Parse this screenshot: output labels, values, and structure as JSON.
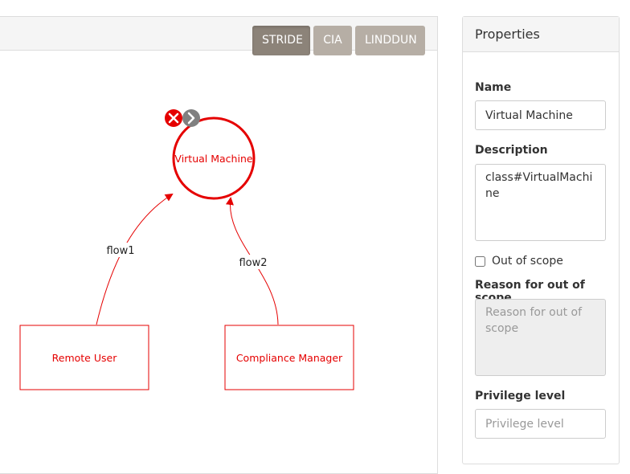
{
  "toolbar": {
    "buttons": [
      {
        "label": "STRIDE",
        "active": true
      },
      {
        "label": "CIA",
        "active": false
      },
      {
        "label": "LINDDUN",
        "active": false
      }
    ]
  },
  "diagram": {
    "process": {
      "label": "Virtual Machine"
    },
    "actors": [
      {
        "label": "Remote User"
      },
      {
        "label": "Compliance Manager"
      }
    ],
    "flows": [
      {
        "label": "flow1"
      },
      {
        "label": "flow2"
      }
    ],
    "tools": {
      "remove": "close-icon",
      "link": "chevron-right-icon"
    },
    "colors": {
      "element": "#e50000",
      "flow": "#e50000"
    }
  },
  "properties": {
    "heading": "Properties",
    "name_label": "Name",
    "name_value": "Virtual Machine",
    "description_label": "Description",
    "description_value": "class#VirtualMachine",
    "out_of_scope_label": "Out of scope",
    "out_of_scope_checked": false,
    "reason_label": "Reason for out of scope",
    "reason_placeholder": "Reason for out of scope",
    "privilege_label": "Privilege level",
    "privilege_placeholder": "Privilege level"
  }
}
